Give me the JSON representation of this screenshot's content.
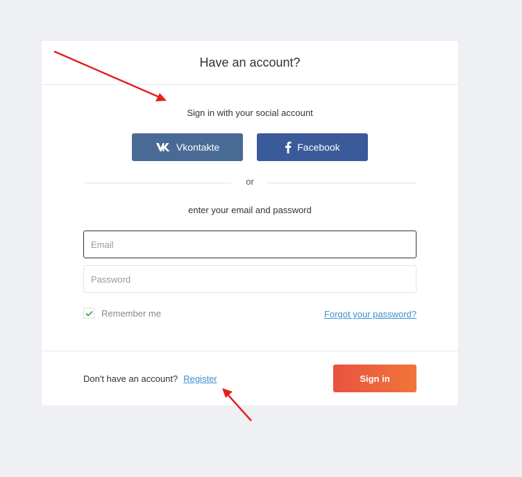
{
  "card": {
    "title": "Have an account?"
  },
  "social": {
    "title": "Sign in with your social account",
    "vk_label": "Vkontakte",
    "fb_label": "Facebook"
  },
  "divider": {
    "text": "or"
  },
  "email_section": {
    "title": "enter your email and password",
    "email_placeholder": "Email",
    "email_value": "",
    "password_placeholder": "Password",
    "password_value": ""
  },
  "options": {
    "remember_label": "Remember me",
    "remember_checked": true,
    "forgot_label": "Forgot your password?"
  },
  "footer": {
    "no_account_text": "Don't have an account?",
    "register_label": "Register",
    "signin_label": "Sign in"
  },
  "colors": {
    "background": "#eef0f4",
    "vk": "#4a6a96",
    "facebook": "#3b5a9a",
    "link": "#3b8fcf",
    "signin_start": "#e9523f",
    "signin_end": "#f07539",
    "check": "#4caf50",
    "arrow": "#e32020"
  }
}
